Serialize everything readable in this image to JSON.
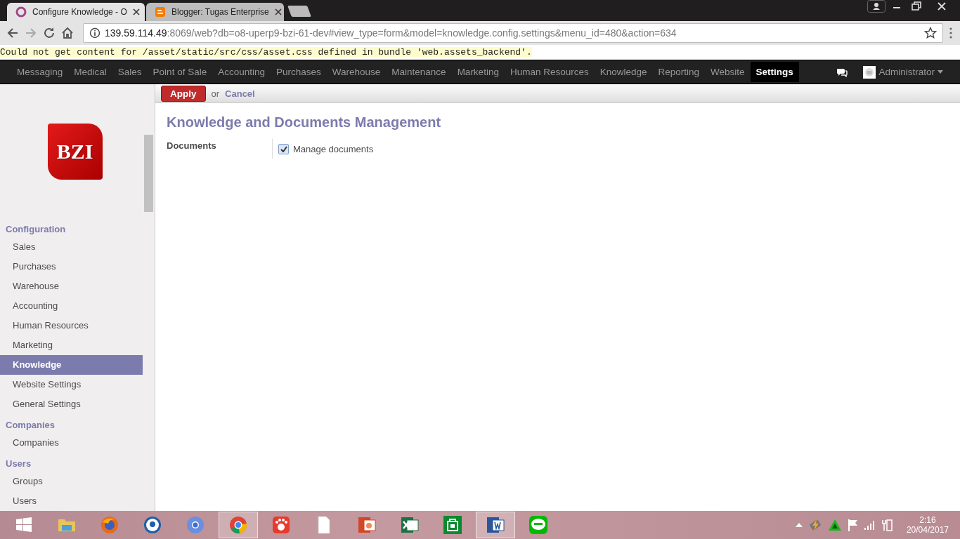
{
  "browser": {
    "tabs": [
      {
        "title": "Configure Knowledge - O",
        "selected": true,
        "kind": "odoo"
      },
      {
        "title": "Blogger: Tugas Enterprise",
        "selected": false,
        "kind": "blogger"
      }
    ],
    "url": {
      "host": "139.59.114.49",
      "rest": ":8069/web?db=o8-uperp9-bzi-61-dev#view_type=form&model=knowledge.config.settings&menu_id=480&action=634"
    },
    "warning": "Could not get content for /asset/static/src/css/asset.css defined in bundle 'web.assets_backend'."
  },
  "top_menu": [
    {
      "label": "Messaging",
      "selected": false
    },
    {
      "label": "Medical",
      "selected": false
    },
    {
      "label": "Sales",
      "selected": false
    },
    {
      "label": "Point of Sale",
      "selected": false
    },
    {
      "label": "Accounting",
      "selected": false
    },
    {
      "label": "Purchases",
      "selected": false
    },
    {
      "label": "Warehouse",
      "selected": false
    },
    {
      "label": "Maintenance",
      "selected": false
    },
    {
      "label": "Marketing",
      "selected": false
    },
    {
      "label": "Human Resources",
      "selected": false
    },
    {
      "label": "Knowledge",
      "selected": false
    },
    {
      "label": "Reporting",
      "selected": false
    },
    {
      "label": "Website",
      "selected": false
    },
    {
      "label": "Settings",
      "selected": true
    }
  ],
  "user": {
    "name": "Administrator"
  },
  "logo": {
    "text": "BZI"
  },
  "sidebar": [
    {
      "title": "Configuration",
      "items": [
        {
          "label": "Sales",
          "selected": false
        },
        {
          "label": "Purchases",
          "selected": false
        },
        {
          "label": "Warehouse",
          "selected": false
        },
        {
          "label": "Accounting",
          "selected": false
        },
        {
          "label": "Human Resources",
          "selected": false
        },
        {
          "label": "Marketing",
          "selected": false
        },
        {
          "label": "Knowledge",
          "selected": true
        },
        {
          "label": "Website Settings",
          "selected": false
        },
        {
          "label": "General Settings",
          "selected": false
        }
      ]
    },
    {
      "title": "Companies",
      "items": [
        {
          "label": "Companies",
          "selected": false
        }
      ]
    },
    {
      "title": "Users",
      "items": [
        {
          "label": "Groups",
          "selected": false
        },
        {
          "label": "Users",
          "selected": false
        }
      ]
    }
  ],
  "form": {
    "apply": "Apply",
    "or": "or",
    "cancel": "Cancel",
    "title": "Knowledge and Documents Management",
    "fields": [
      {
        "label": "Documents",
        "option": "Manage documents",
        "checked": true
      }
    ]
  },
  "taskbar": [
    {
      "kind": "start",
      "active": false
    },
    {
      "kind": "folder",
      "active": false
    },
    {
      "kind": "globe",
      "active": false
    },
    {
      "kind": "disc",
      "active": false
    },
    {
      "kind": "circle",
      "active": false
    },
    {
      "kind": "browser",
      "active": true
    },
    {
      "kind": "footprint",
      "active": false
    },
    {
      "kind": "page",
      "active": false
    },
    {
      "kind": "slides",
      "active": false
    },
    {
      "kind": "sheet",
      "active": false
    },
    {
      "kind": "store",
      "active": false
    },
    {
      "kind": "word",
      "active": true
    },
    {
      "kind": "chat",
      "active": false
    }
  ],
  "clock": {
    "time": "2:16",
    "date": "20/04/2017"
  }
}
